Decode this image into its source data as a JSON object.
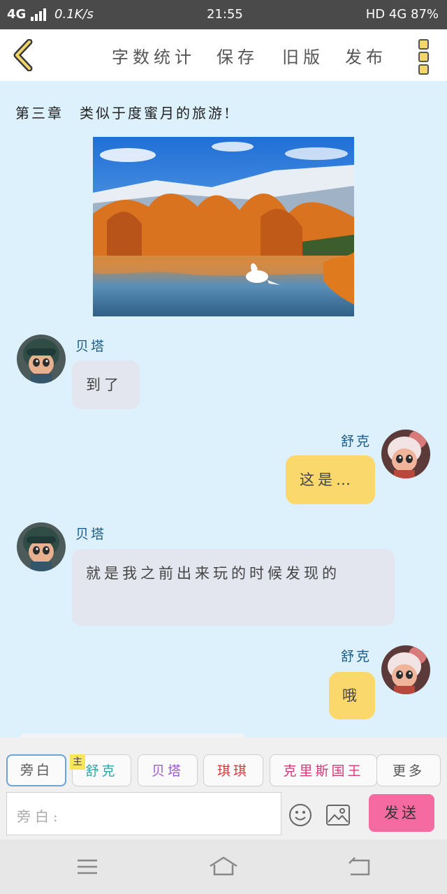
{
  "status_bar": {
    "network": "4G",
    "speed": "0.1K/s",
    "time": "21:55",
    "right": "HD 4G 87%"
  },
  "toolbar": {
    "word_count": "字数统计",
    "save": "保存",
    "old_version": "旧版",
    "publish": "发布"
  },
  "chapter_title": "第三章　类似于度蜜月的旅游!",
  "messages": [
    {
      "speaker": "贝塔",
      "side": "left",
      "text": "到了"
    },
    {
      "speaker": "舒克",
      "side": "right",
      "text": "这是…"
    },
    {
      "speaker": "贝塔",
      "side": "left",
      "text": "就是我之前出来玩的时候发现的"
    },
    {
      "speaker": "舒克",
      "side": "right",
      "text": "哦"
    }
  ],
  "characters": [
    {
      "label": "旁白",
      "color": "#555555"
    },
    {
      "label": "舒克",
      "color": "#2aa8a6",
      "badge": "主"
    },
    {
      "label": "贝塔",
      "color": "#9b59d6"
    },
    {
      "label": "琪琪",
      "color": "#d23c3c"
    },
    {
      "label": "克里斯国王",
      "color": "#d23c7a"
    },
    {
      "label": "更多",
      "color": "#555555"
    }
  ],
  "input": {
    "placeholder": "旁白:"
  },
  "send_label": "发送",
  "colors": {
    "content_bg": "#dcf1fb",
    "left_bubble": "#e3e6ee",
    "right_bubble": "#fbd86b",
    "send": "#f56aa0",
    "name": "#1c5c8a"
  }
}
